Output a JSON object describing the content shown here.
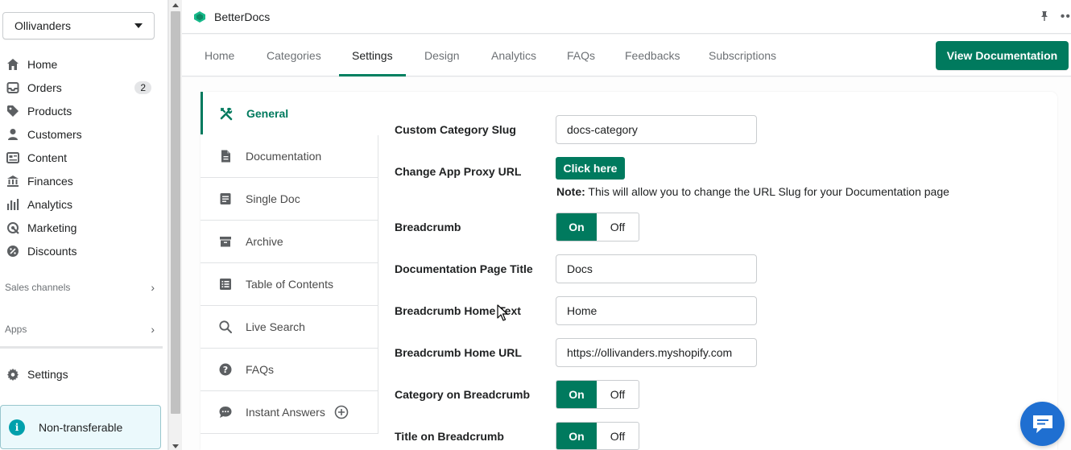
{
  "sidebar": {
    "store_name": "Ollivanders",
    "items": [
      {
        "label": "Home"
      },
      {
        "label": "Orders",
        "badge": "2"
      },
      {
        "label": "Products"
      },
      {
        "label": "Customers"
      },
      {
        "label": "Content"
      },
      {
        "label": "Finances"
      },
      {
        "label": "Analytics"
      },
      {
        "label": "Marketing"
      },
      {
        "label": "Discounts"
      }
    ],
    "sales_channels": "Sales channels",
    "apps": "Apps",
    "settings": "Settings",
    "notice": "Non-transferable"
  },
  "app": {
    "name": "BetterDocs"
  },
  "tabs": [
    {
      "label": "Home"
    },
    {
      "label": "Categories"
    },
    {
      "label": "Settings",
      "active": true
    },
    {
      "label": "Design"
    },
    {
      "label": "Analytics"
    },
    {
      "label": "FAQs"
    },
    {
      "label": "Feedbacks"
    },
    {
      "label": "Subscriptions"
    }
  ],
  "view_documentation_label": "View Documentation",
  "settings_menu": [
    {
      "label": "General",
      "icon": "tools-icon",
      "active": true
    },
    {
      "label": "Documentation",
      "icon": "document-icon"
    },
    {
      "label": "Single Doc",
      "icon": "single-doc-icon"
    },
    {
      "label": "Archive",
      "icon": "archive-icon"
    },
    {
      "label": "Table of Contents",
      "icon": "list-icon"
    },
    {
      "label": "Live Search",
      "icon": "search-icon"
    },
    {
      "label": "FAQs",
      "icon": "question-icon"
    },
    {
      "label": "Instant Answers",
      "icon": "chat-icon"
    }
  ],
  "form": {
    "custom_category_slug": {
      "label": "Custom Category Slug",
      "value": "docs-category"
    },
    "change_app_proxy_url": {
      "label": "Change App Proxy URL",
      "button": "Click here",
      "note_bold": "Note:",
      "note": " This will allow you to change the URL Slug for your Documentation page"
    },
    "breadcrumb": {
      "label": "Breadcrumb",
      "on": "On",
      "off": "Off"
    },
    "documentation_page_title": {
      "label": "Documentation Page Title",
      "value": "Docs"
    },
    "breadcrumb_home_text": {
      "label": "Breadcrumb Home Text",
      "value": "Home"
    },
    "breadcrumb_home_url": {
      "label": "Breadcrumb Home URL",
      "value": "https://ollivanders.myshopify.com"
    },
    "category_on_breadcrumb": {
      "label": "Category on Breadcrumb",
      "on": "On",
      "off": "Off"
    },
    "title_on_breadcrumb": {
      "label": "Title on Breadcrumb",
      "on": "On",
      "off": "Off"
    }
  },
  "colors": {
    "primary": "#007a5e",
    "chat": "#1f6fd1",
    "info": "#00a0ac"
  }
}
